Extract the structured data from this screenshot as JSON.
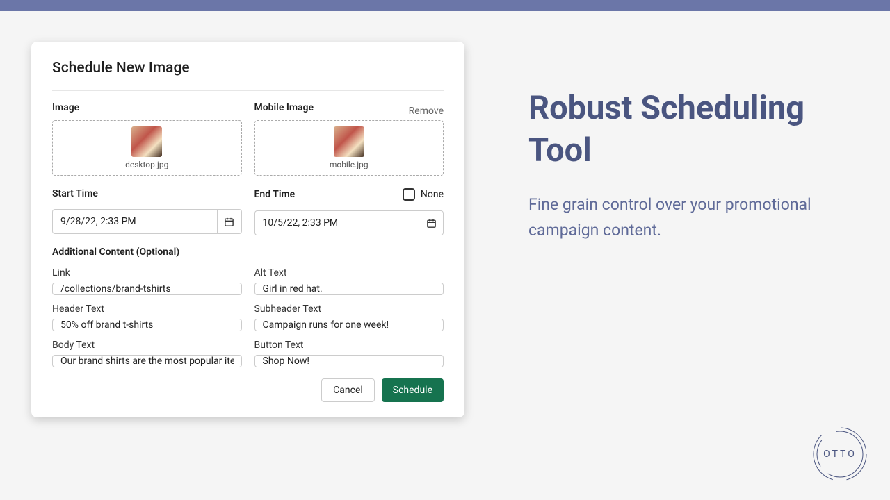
{
  "modal": {
    "title": "Schedule New Image",
    "image_label": "Image",
    "mobile_image_label": "Mobile Image",
    "remove_label": "Remove",
    "desktop_filename": "desktop.jpg",
    "mobile_filename": "mobile.jpg",
    "start_time_label": "Start Time",
    "end_time_label": "End Time",
    "none_label": "None",
    "start_time_value": "9/28/22, 2:33 PM",
    "end_time_value": "10/5/22, 2:33 PM",
    "additional_label": "Additional Content (Optional)",
    "link_label": "Link",
    "link_value": "/collections/brand-tshirts",
    "alt_label": "Alt Text",
    "alt_value": "Girl in red hat.",
    "header_label": "Header Text",
    "header_value": "50% off brand t-shirts",
    "subheader_label": "Subheader Text",
    "subheader_value": "Campaign runs for one week!",
    "body_label": "Body Text",
    "body_value": "Our brand shirts are the most popular item",
    "button_label": "Button Text",
    "button_value": "Shop Now!",
    "cancel_label": "Cancel",
    "schedule_label": "Schedule"
  },
  "marketing": {
    "heading": "Robust Scheduling Tool",
    "sub": "Fine grain control over your promotional campaign content."
  },
  "logo": {
    "text": "OTTO"
  },
  "colors": {
    "accent_bar": "#6b76a8",
    "button_primary": "#16734f",
    "heading": "#4a5580"
  }
}
